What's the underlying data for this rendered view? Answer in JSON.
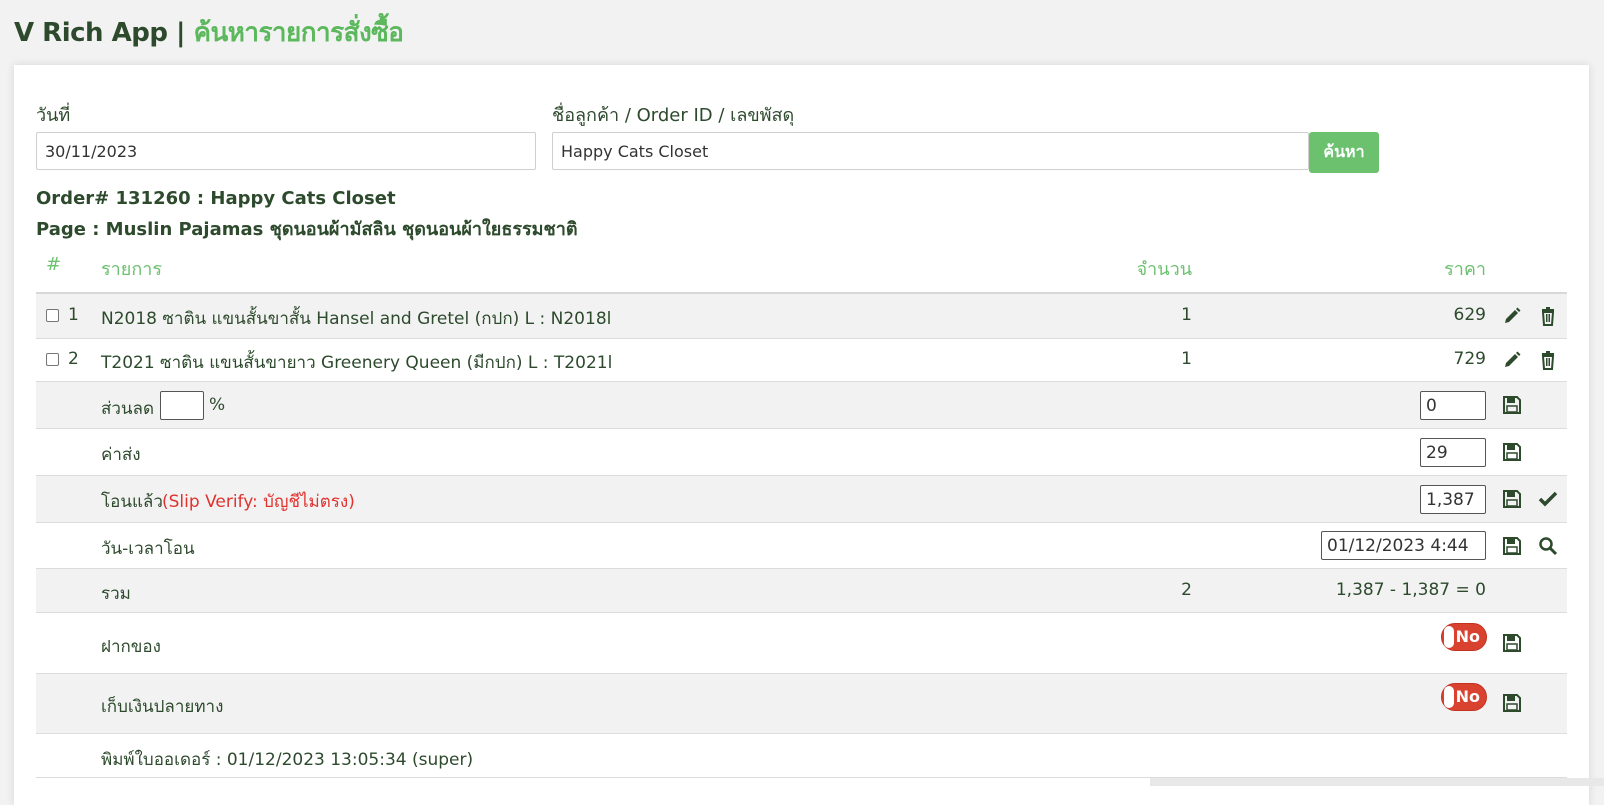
{
  "header": {
    "app_name": "V Rich App",
    "separator": "|",
    "page_title": "ค้นหารายการสั่งซื้อ"
  },
  "search": {
    "date_label": "วันที่",
    "date_value": "30/11/2023",
    "customer_label": "ชื่อลูกค้า / Order ID / เลขพัสดุ",
    "customer_value": "Happy Cats Closet",
    "search_button": "ค้นหา"
  },
  "order": {
    "title": "Order# 131260 : Happy Cats Closet",
    "page": "Page : Muslin Pajamas ชุดนอนผ้ามัสลิน ชุดนอนผ้าใยธรรมชาติ"
  },
  "table": {
    "headers": {
      "index": "#",
      "item": "รายการ",
      "quantity": "จำนวน",
      "price": "ราคา"
    },
    "items": [
      {
        "index": "1",
        "name": "N2018 ซาติน แขนสั้นขาสั้น Hansel and Gretel (กปก) L : N2018l",
        "quantity": "1",
        "price": "629"
      },
      {
        "index": "2",
        "name": "T2021 ซาติน แขนสั้นขายาว Greenery Queen (มีกปก) L : T2021l",
        "quantity": "1",
        "price": "729"
      }
    ]
  },
  "discount": {
    "label": "ส่วนลด",
    "percent_value": "",
    "percent_sign": "%",
    "amount_value": "0"
  },
  "shipping": {
    "label": "ค่าส่ง",
    "value": "29"
  },
  "transfer": {
    "label": "โอนแล้ว",
    "verify_note": "(Slip Verify: บัญชีไม่ตรง)",
    "value": "1,387"
  },
  "transfer_time": {
    "label": "วัน-เวลาโอน",
    "value": "01/12/2023 4:44"
  },
  "total": {
    "label": "รวม",
    "quantity": "2",
    "summary": "1,387 - 1,387 = 0"
  },
  "deposit": {
    "label": "ฝากของ",
    "toggle": "No"
  },
  "cod": {
    "label": "เก็บเงินปลายทาง",
    "toggle": "No"
  },
  "printed": {
    "text": "พิมพ์ใบออเดอร์ : 01/12/2023 13:05:34 (super)"
  },
  "colors": {
    "accent_green": "#6cc16f",
    "dark_green": "#2d4a2d",
    "toggle_red": "#d9422f",
    "warning_red": "#e0322f"
  },
  "icons": [
    "pencil-icon",
    "trash-icon",
    "save-icon",
    "check-icon",
    "search-icon"
  ]
}
